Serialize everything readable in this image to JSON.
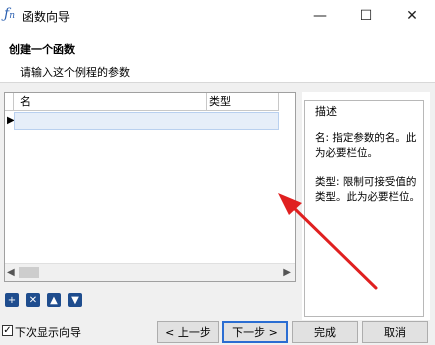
{
  "window": {
    "title": "函数向导",
    "app_icon": "fx-icon"
  },
  "header": {
    "title": "创建一个函数",
    "subtitle": "请输入这个例程的参数"
  },
  "grid": {
    "columns": [
      "名",
      "类型"
    ],
    "rows": [
      {
        "name": "",
        "type": ""
      }
    ]
  },
  "description": {
    "caption": "描述",
    "text1": "名: 指定参数的名。此为必要栏位。",
    "text2": "类型: 限制可接受值的类型。此为必要栏位。"
  },
  "toolbar": {
    "icons": [
      "add-icon",
      "delete-icon",
      "move-up-icon",
      "move-down-icon"
    ]
  },
  "footer": {
    "show_wizard_label": "下次显示向导",
    "show_wizard_checked": true,
    "prev_label": "< 上一步",
    "next_label": "下一步 >",
    "finish_label": "完成",
    "cancel_label": "取消"
  },
  "colors": {
    "accent": "#2a6dd2",
    "arrow": "#e02020",
    "tool_button": "#1f4d8e"
  }
}
